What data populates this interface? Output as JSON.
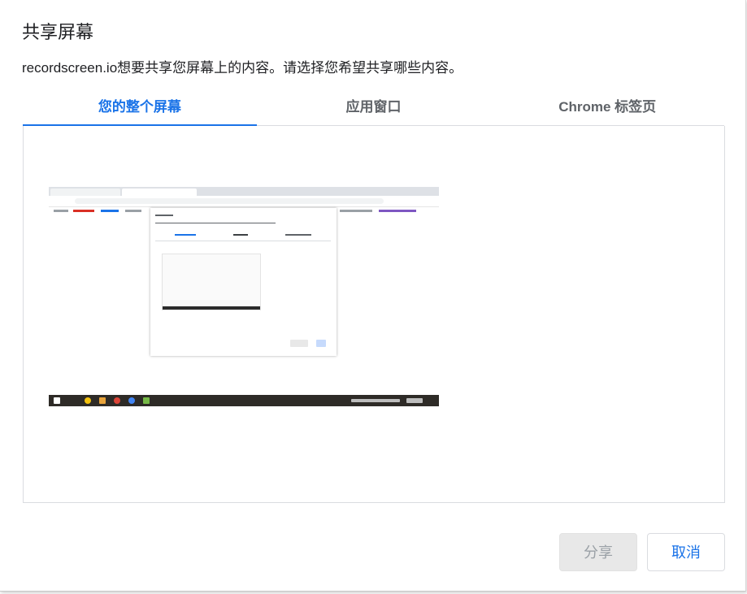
{
  "dialog": {
    "title": "共享屏幕",
    "subtitle": "recordscreen.io想要共享您屏幕上的内容。请选择您希望共享哪些内容。"
  },
  "tabs": [
    {
      "label": "您的整个屏幕",
      "active": true
    },
    {
      "label": "应用窗口",
      "active": false
    },
    {
      "label": "Chrome 标签页",
      "active": false
    }
  ],
  "buttons": {
    "share": "分享",
    "cancel": "取消"
  },
  "colors": {
    "accent": "#1a73e8",
    "disabled_text": "#9aa0a6",
    "text": "#202124"
  }
}
